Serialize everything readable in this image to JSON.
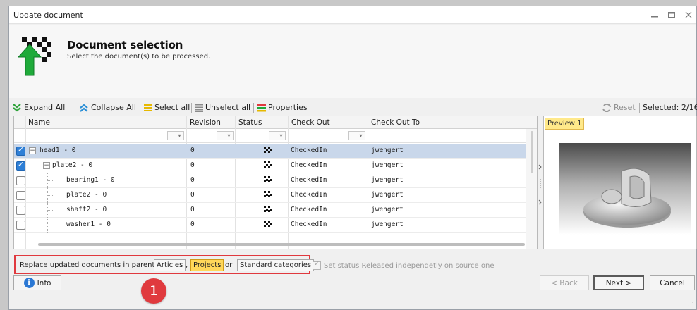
{
  "window": {
    "title": "Update document"
  },
  "header": {
    "title": "Document selection",
    "subtitle": "Select the document(s) to be processed."
  },
  "toolbar": {
    "expand_all": "Expand All",
    "collapse_all": "Collapse All",
    "select_all": "Select all",
    "unselect_all": "Unselect all",
    "properties": "Properties",
    "reset": "Reset",
    "selected": "Selected: 2/16"
  },
  "grid": {
    "columns": [
      "Name",
      "Revision",
      "Status",
      "Check Out",
      "Check Out To"
    ],
    "rows": [
      {
        "name": "head1 - 0",
        "revision": "0",
        "status_icon": "checkered-flag-icon",
        "checkout": "CheckedIn",
        "checkout_to": "jwengert",
        "checked": true,
        "selected": true,
        "level": 0,
        "expander": "minus"
      },
      {
        "name": "plate2 - 0",
        "revision": "0",
        "status_icon": "checkered-flag-icon",
        "checkout": "CheckedIn",
        "checkout_to": "jwengert",
        "checked": true,
        "selected": false,
        "level": 1,
        "expander": "minus"
      },
      {
        "name": "bearing1 - 0",
        "revision": "0",
        "status_icon": "checkered-flag-icon",
        "checkout": "CheckedIn",
        "checkout_to": "jwengert",
        "checked": false,
        "selected": false,
        "level": 2
      },
      {
        "name": "plate2 - 0",
        "revision": "0",
        "status_icon": "checkered-flag-icon",
        "checkout": "CheckedIn",
        "checkout_to": "jwengert",
        "checked": false,
        "selected": false,
        "level": 2
      },
      {
        "name": "shaft2 - 0",
        "revision": "0",
        "status_icon": "checkered-flag-icon",
        "checkout": "CheckedIn",
        "checkout_to": "jwengert",
        "checked": false,
        "selected": false,
        "level": 2
      },
      {
        "name": "washer1 - 0",
        "revision": "0",
        "status_icon": "checkered-flag-icon",
        "checkout": "CheckedIn",
        "checkout_to": "jwengert",
        "checked": false,
        "selected": false,
        "level": 2
      }
    ]
  },
  "preview": {
    "tab": "Preview 1"
  },
  "replace": {
    "label": "Replace updated documents in parent",
    "articles": "Articles",
    "comma": ",",
    "projects": "Projects",
    "or": "or",
    "standard": "Standard categories",
    "status_label": "Set status Released independetly on source one"
  },
  "buttons": {
    "info": "Info",
    "back": "< Back",
    "next": "Next >",
    "cancel": "Cancel"
  },
  "callout": {
    "number": "1"
  },
  "colors": {
    "accent": "#2b78d4",
    "highlight": "#ffd75a",
    "callout": "#e03a3e"
  }
}
